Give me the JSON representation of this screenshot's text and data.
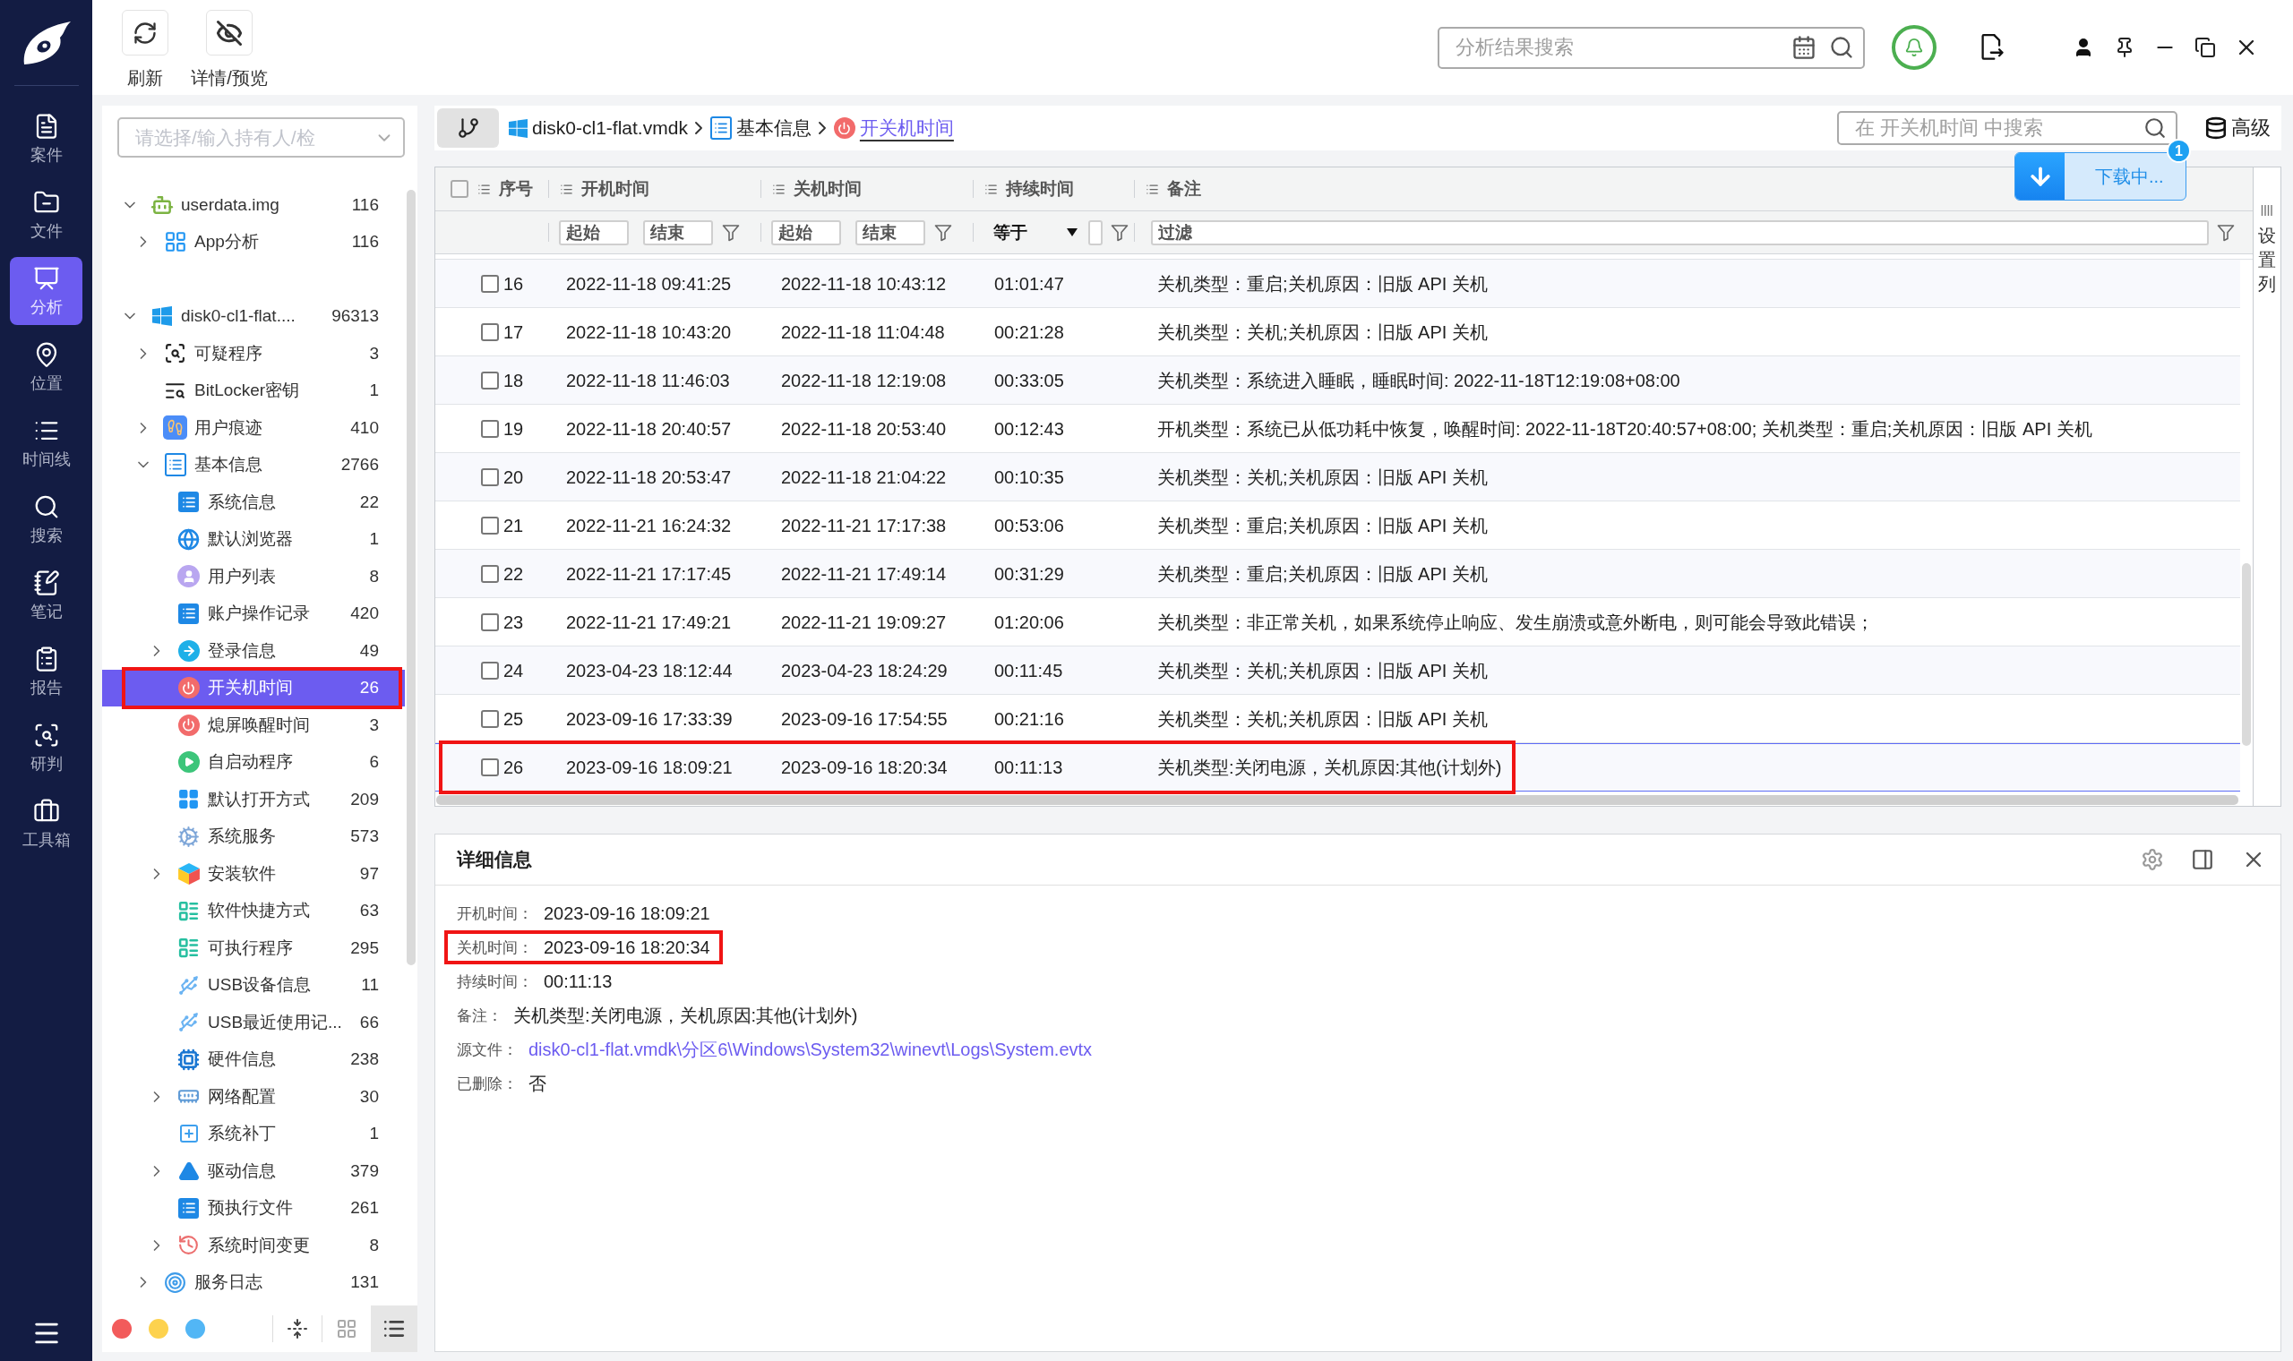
{
  "nav": {
    "items": [
      {
        "label": "案件",
        "kind": "case",
        "selected": false
      },
      {
        "label": "文件",
        "kind": "folder",
        "selected": false
      },
      {
        "label": "分析",
        "kind": "analysis",
        "selected": true
      },
      {
        "label": "位置",
        "kind": "location",
        "selected": false
      },
      {
        "label": "时间线",
        "kind": "timeline",
        "selected": false
      },
      {
        "label": "搜索",
        "kind": "search",
        "selected": false
      },
      {
        "label": "笔记",
        "kind": "note",
        "selected": false
      },
      {
        "label": "报告",
        "kind": "report",
        "selected": false
      },
      {
        "label": "研判",
        "kind": "judge",
        "selected": false
      },
      {
        "label": "工具箱",
        "kind": "toolbox",
        "selected": false
      }
    ]
  },
  "toolbar": {
    "buttons": [
      {
        "label": "刷新",
        "kind": "refresh"
      },
      {
        "label": "详情/预览",
        "kind": "preview"
      }
    ],
    "search": {
      "placeholder": "分析结果搜索"
    }
  },
  "sidebar": {
    "holder_select": {
      "placeholder": "请选择/输入持有人/检"
    },
    "tree": [
      {
        "label": "userdata.img",
        "count": "116",
        "kind": "robot",
        "expanded": true,
        "selected": false,
        "marked": false,
        "children": [
          {
            "label": "App分析",
            "count": "116",
            "kind": "apps",
            "expanded": false,
            "selected": false,
            "marked": false
          }
        ]
      },
      {
        "label": "disk0-cl1-flat....",
        "count": "96313",
        "kind": "windows",
        "expanded": true,
        "selected": false,
        "marked": false,
        "children": [
          {
            "label": "可疑程序",
            "count": "3",
            "kind": "inspect",
            "expanded": false,
            "selected": false,
            "marked": false
          },
          {
            "label": "BitLocker密钥",
            "count": "1",
            "kind": "keysearch",
            "selected": false,
            "marked": false
          },
          {
            "label": "用户痕迹",
            "count": "410",
            "kind": "footprints",
            "expanded": false,
            "selected": false,
            "marked": false
          },
          {
            "label": "基本信息",
            "count": "2766",
            "kind": "list",
            "expanded": true,
            "selected": false,
            "marked": false,
            "children": [
              {
                "label": "系统信息",
                "count": "22",
                "kind": "card",
                "selected": false,
                "marked": false
              },
              {
                "label": "默认浏览器",
                "count": "1",
                "kind": "browser",
                "selected": false,
                "marked": false
              },
              {
                "label": "用户列表",
                "count": "8",
                "kind": "user",
                "selected": false,
                "marked": false
              },
              {
                "label": "账户操作记录",
                "count": "420",
                "kind": "card",
                "selected": false,
                "marked": false
              },
              {
                "label": "登录信息",
                "count": "49",
                "kind": "login",
                "expanded": false,
                "selected": false,
                "marked": false
              },
              {
                "label": "开关机时间",
                "count": "26",
                "kind": "power",
                "selected": true,
                "marked": true
              },
              {
                "label": "熄屏唤醒时间",
                "count": "3",
                "kind": "power",
                "selected": false,
                "marked": false
              },
              {
                "label": "自启动程序",
                "count": "6",
                "kind": "play",
                "selected": false,
                "marked": false
              },
              {
                "label": "默认打开方式",
                "count": "209",
                "kind": "tiles",
                "selected": false,
                "marked": false
              },
              {
                "label": "系统服务",
                "count": "573",
                "kind": "gears",
                "selected": false,
                "marked": false
              },
              {
                "label": "安装软件",
                "count": "97",
                "kind": "cube",
                "expanded": false,
                "selected": false,
                "marked": false
              },
              {
                "label": "软件快捷方式",
                "count": "63",
                "kind": "bars",
                "selected": false,
                "marked": false
              },
              {
                "label": "可执行程序",
                "count": "295",
                "kind": "bars",
                "selected": false,
                "marked": false
              },
              {
                "label": "USB设备信息",
                "count": "11",
                "kind": "usb",
                "selected": false,
                "marked": false
              },
              {
                "label": "USB最近使用记...",
                "count": "66",
                "kind": "usb",
                "selected": false,
                "marked": false
              },
              {
                "label": "硬件信息",
                "count": "238",
                "kind": "chip",
                "selected": false,
                "marked": false
              },
              {
                "label": "网络配置",
                "count": "30",
                "kind": "netcard",
                "expanded": false,
                "selected": false,
                "marked": false
              },
              {
                "label": "系统补丁",
                "count": "1",
                "kind": "patch",
                "selected": false,
                "marked": false
              },
              {
                "label": "驱动信息",
                "count": "379",
                "kind": "drive",
                "expanded": false,
                "selected": false,
                "marked": false
              },
              {
                "label": "预执行文件",
                "count": "261",
                "kind": "doc",
                "selected": false,
                "marked": false
              },
              {
                "label": "系统时间变更",
                "count": "8",
                "kind": "clock",
                "expanded": false,
                "selected": false,
                "marked": false
              }
            ]
          },
          {
            "label": "服务日志",
            "count": "131",
            "kind": "service",
            "expanded": false,
            "selected": false,
            "marked": false
          }
        ]
      }
    ],
    "color_tags": [
      {
        "color": "#f25b5b"
      },
      {
        "color": "#fdd24e"
      },
      {
        "color": "#52b6f5"
      }
    ],
    "views": [
      {
        "kind": "collapse",
        "selected": false
      },
      {
        "kind": "grid",
        "selected": false
      },
      {
        "kind": "list",
        "selected": true
      }
    ]
  },
  "breadcrumb": [
    {
      "label": "disk0-cl1-flat.vmdk",
      "kind": "windows",
      "selected": false
    },
    {
      "label": "基本信息",
      "kind": "list",
      "selected": false
    },
    {
      "label": "开关机时间",
      "kind": "power",
      "selected": true
    }
  ],
  "table_search": {
    "placeholder": "在 开关机时间 中搜索"
  },
  "advanced_button": {
    "label": "高级"
  },
  "download": {
    "label": "下载中...",
    "badge": "1"
  },
  "table": {
    "header_checked": false,
    "columns": [
      {
        "label": "序号"
      },
      {
        "label": "开机时间"
      },
      {
        "label": "关机时间"
      },
      {
        "label": "持续时间"
      },
      {
        "label": "备注"
      }
    ],
    "filters": [
      {
        "kind": "range",
        "inputs": [
          {
            "placeholder": "起始"
          },
          {
            "placeholder": "结束"
          }
        ]
      },
      {
        "kind": "range",
        "inputs": [
          {
            "placeholder": "起始"
          },
          {
            "placeholder": "结束"
          }
        ]
      },
      {
        "kind": "compare",
        "operator": "等于"
      },
      {
        "kind": "text",
        "placeholder": "过滤"
      }
    ],
    "rows": [
      {
        "index": "16",
        "start": "2022-11-18 09:41:25",
        "end": "2022-11-18 10:43:12",
        "duration": "01:01:47",
        "remark": "关机类型：重启;关机原因：旧版 API 关机",
        "checked": false,
        "selected": false,
        "marked": false
      },
      {
        "index": "17",
        "start": "2022-11-18 10:43:20",
        "end": "2022-11-18 11:04:48",
        "duration": "00:21:28",
        "remark": "关机类型：关机;关机原因：旧版 API 关机",
        "checked": false,
        "selected": false,
        "marked": false
      },
      {
        "index": "18",
        "start": "2022-11-18 11:46:03",
        "end": "2022-11-18 12:19:08",
        "duration": "00:33:05",
        "remark": "关机类型：系统进入睡眠，睡眠时间: 2022-11-18T12:19:08+08:00",
        "checked": false,
        "selected": false,
        "marked": false
      },
      {
        "index": "19",
        "start": "2022-11-18 20:40:57",
        "end": "2022-11-18 20:53:40",
        "duration": "00:12:43",
        "remark": "开机类型：系统已从低功耗中恢复，唤醒时间: 2022-11-18T20:40:57+08:00; 关机类型：重启;关机原因：旧版 API 关机",
        "checked": false,
        "selected": false,
        "marked": false
      },
      {
        "index": "20",
        "start": "2022-11-18 20:53:47",
        "end": "2022-11-18 21:04:22",
        "duration": "00:10:35",
        "remark": "关机类型：关机;关机原因：旧版 API 关机",
        "checked": false,
        "selected": false,
        "marked": false
      },
      {
        "index": "21",
        "start": "2022-11-21 16:24:32",
        "end": "2022-11-21 17:17:38",
        "duration": "00:53:06",
        "remark": "关机类型：重启;关机原因：旧版 API 关机",
        "checked": false,
        "selected": false,
        "marked": false
      },
      {
        "index": "22",
        "start": "2022-11-21 17:17:45",
        "end": "2022-11-21 17:49:14",
        "duration": "00:31:29",
        "remark": "关机类型：重启;关机原因：旧版 API 关机",
        "checked": false,
        "selected": false,
        "marked": false
      },
      {
        "index": "23",
        "start": "2022-11-21 17:49:21",
        "end": "2022-11-21 19:09:27",
        "duration": "01:20:06",
        "remark": "关机类型：非正常关机，如果系统停止响应、发生崩溃或意外断电，则可能会导致此错误；",
        "checked": false,
        "selected": false,
        "marked": false
      },
      {
        "index": "24",
        "start": "2023-04-23 18:12:44",
        "end": "2023-04-23 18:24:29",
        "duration": "00:11:45",
        "remark": "关机类型：关机;关机原因：旧版 API 关机",
        "checked": false,
        "selected": false,
        "marked": false
      },
      {
        "index": "25",
        "start": "2023-09-16 17:33:39",
        "end": "2023-09-16 17:54:55",
        "duration": "00:21:16",
        "remark": "关机类型：关机;关机原因：旧版 API 关机",
        "checked": false,
        "selected": false,
        "marked": false
      },
      {
        "index": "26",
        "start": "2023-09-16 18:09:21",
        "end": "2023-09-16 18:20:34",
        "duration": "00:11:13",
        "remark": "关机类型:关闭电源，关机原因:其他(计划外)",
        "checked": false,
        "selected": true,
        "marked": true
      }
    ]
  },
  "column_settings": {
    "label": "设置列"
  },
  "details": {
    "title": "详细信息",
    "fields": [
      {
        "label": "开机时间：",
        "value": "2023-09-16 18:09:21",
        "kind": "text",
        "marked": false
      },
      {
        "label": "关机时间：",
        "value": "2023-09-16 18:20:34",
        "kind": "text",
        "marked": true
      },
      {
        "label": "持续时间：",
        "value": "00:11:13",
        "kind": "text",
        "marked": false
      },
      {
        "label": "备注：",
        "value": "关机类型:关闭电源，关机原因:其他(计划外)",
        "kind": "text",
        "marked": false
      },
      {
        "label": "源文件：",
        "value": "disk0-cl1-flat.vmdk\\分区6\\Windows\\System32\\winevt\\Logs\\System.evtx",
        "kind": "link",
        "marked": false
      },
      {
        "label": "已删除：",
        "value": "否",
        "kind": "text",
        "marked": false
      }
    ]
  }
}
